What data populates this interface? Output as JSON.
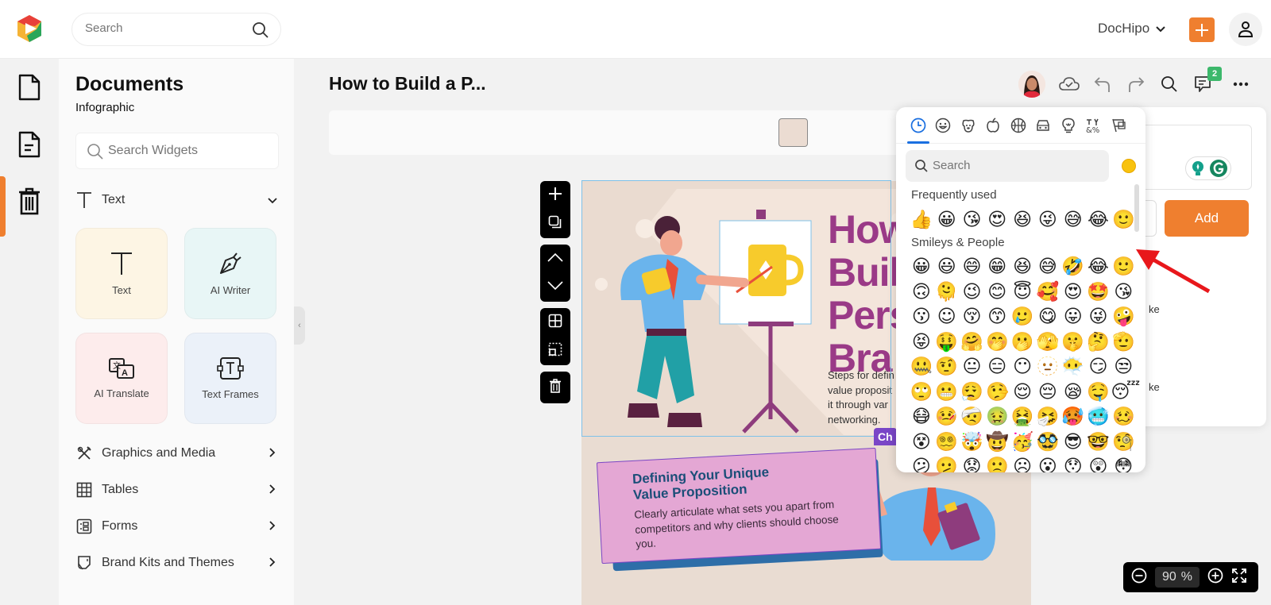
{
  "topbar": {
    "search_placeholder": "Search",
    "workspace_name": "DocHipo",
    "create_button": "+",
    "profile_icon": "user-icon"
  },
  "rail": {
    "items": [
      {
        "name": "documents",
        "icon": "document-icon"
      },
      {
        "name": "current-document",
        "icon": "document-lines-icon",
        "active": true
      },
      {
        "name": "trash",
        "icon": "trash-icon"
      }
    ],
    "accent_color": "#ef7f2f"
  },
  "panel": {
    "title": "Documents",
    "subtitle": "Infographic",
    "search_placeholder": "Search Widgets",
    "text_section": {
      "label": "Text",
      "expanded": true
    },
    "tiles": [
      {
        "label": "Text",
        "icon": "text-icon",
        "bg": "#fdf5e4"
      },
      {
        "label": "AI Writer",
        "icon": "pen-nib-icon",
        "bg": "#e8f6f6"
      },
      {
        "label": "AI Translate",
        "icon": "translate-icon",
        "bg": "#fdecec"
      },
      {
        "label": "Text Frames",
        "icon": "text-frame-icon",
        "bg": "#ebf1f9"
      }
    ],
    "sections": [
      {
        "label": "Graphics and Media",
        "icon": "graphics-icon"
      },
      {
        "label": "Tables",
        "icon": "table-icon"
      },
      {
        "label": "Forms",
        "icon": "form-icon"
      },
      {
        "label": "Brand Kits and Themes",
        "icon": "brand-kit-icon"
      }
    ]
  },
  "editor": {
    "doc_title": "How to Build a P...",
    "comment_count": "2",
    "swatch_color": "#ebdcd2",
    "zoom_value": "90",
    "zoom_unit": "%"
  },
  "canvas": {
    "hero_title_lines": [
      "How",
      "Buil",
      "Pers",
      "Bra"
    ],
    "hero_sub_lines": [
      "Steps for defin",
      "value proposit",
      "it through var",
      "networking."
    ],
    "char_tag": "Ch",
    "card_title_1": "Defining Your Unique",
    "card_title_2": "Value Proposition",
    "card_text": "Clearly articulate what sets you apart from competitors and why clients should choose you."
  },
  "emoji_picker": {
    "categories": [
      "recent",
      "smileys",
      "animals",
      "food",
      "activities",
      "travel",
      "objects",
      "symbols",
      "flags"
    ],
    "active_category": "recent",
    "search_placeholder": "Search",
    "frequently_used_label": "Frequently used",
    "smileys_label": "Smileys & People",
    "frequently_used": [
      "👍",
      "😀",
      "😘",
      "😍",
      "😆",
      "😜",
      "😅",
      "😂",
      "🙂"
    ],
    "smileys_rows": [
      [
        "😀",
        "😃",
        "😄",
        "😁",
        "😆",
        "😅",
        "🤣",
        "😂",
        "🙂"
      ],
      [
        "🙃",
        "🫠",
        "😉",
        "😊",
        "😇",
        "🥰",
        "😍",
        "🤩",
        "😘"
      ],
      [
        "😗",
        "☺",
        "😚",
        "😙",
        "🥲",
        "😋",
        "😛",
        "😜",
        "🤪"
      ],
      [
        "😝",
        "🤑",
        "🤗",
        "🤭",
        "🫢",
        "🫣",
        "🤫",
        "🤔",
        "🫡"
      ],
      [
        "🤐",
        "🤨",
        "😐",
        "😑",
        "😶",
        "🫥",
        "😶‍🌫️",
        "😏",
        "😒"
      ],
      [
        "🙄",
        "😬",
        "😮‍💨",
        "🤥",
        "😌",
        "😔",
        "😪",
        "🤤",
        "😴"
      ],
      [
        "😷",
        "🤒",
        "🤕",
        "🤢",
        "🤮",
        "🤧",
        "🥵",
        "🥶",
        "🥴"
      ],
      [
        "😵",
        "😵‍💫",
        "🤯",
        "🤠",
        "🥳",
        "🥸",
        "😎",
        "🤓",
        "🧐"
      ],
      [
        "😕",
        "🫤",
        "😟",
        "🙁",
        "☹",
        "😮",
        "😯",
        "😲",
        "😳"
      ]
    ]
  },
  "comment_panel": {
    "add_button": "Add",
    "fragment_1": "ke",
    "fragment_2": "ke"
  }
}
